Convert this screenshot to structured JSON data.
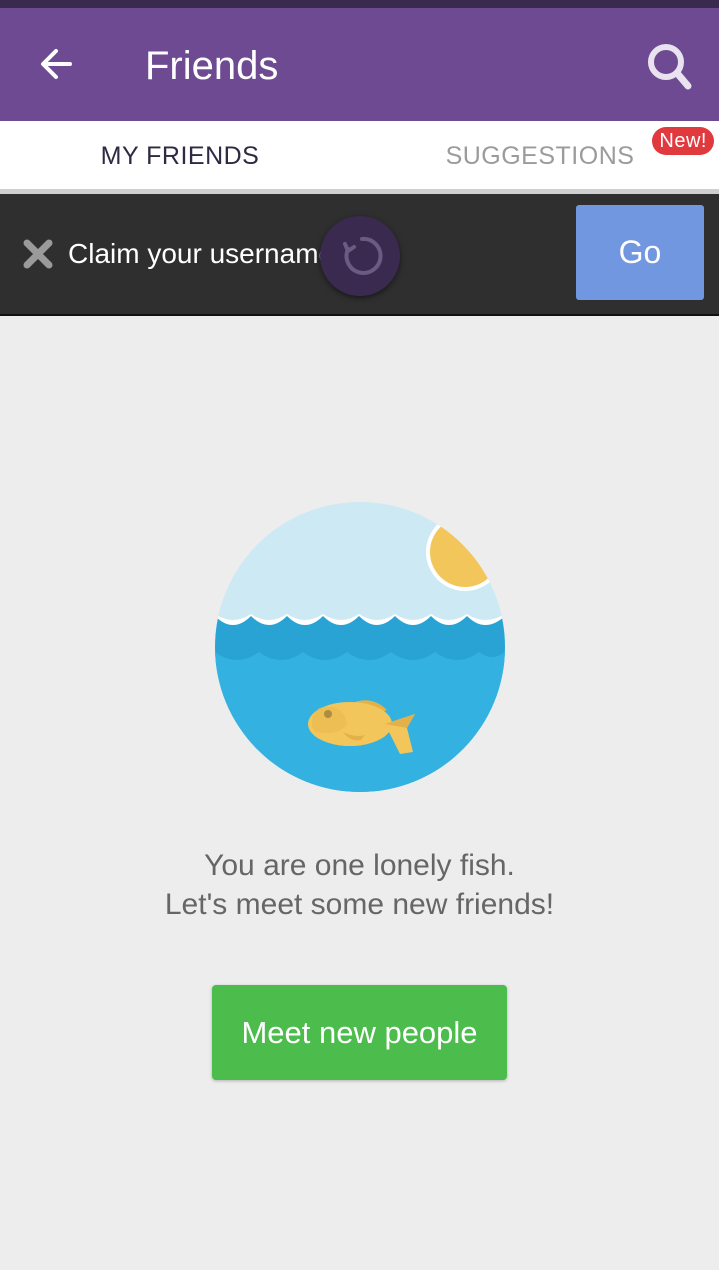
{
  "header": {
    "title": "Friends",
    "back_icon": "arrow-left-icon",
    "search_icon": "search-icon",
    "color": "#6e4a93"
  },
  "tabs": [
    {
      "label": "MY FRIENDS",
      "active": true
    },
    {
      "label": "SUGGESTIONS",
      "active": false,
      "badge": "New!"
    }
  ],
  "banner": {
    "text": "Claim your username",
    "close_icon": "close-icon",
    "button_label": "Go",
    "button_color": "#7197e0"
  },
  "empty_state": {
    "illustration_icon": "fish-in-sea-icon",
    "line1": "You are one lonely fish.",
    "line2": "Let's meet some new friends!"
  },
  "cta": {
    "label": "Meet new people",
    "color": "#4cbd4c"
  }
}
